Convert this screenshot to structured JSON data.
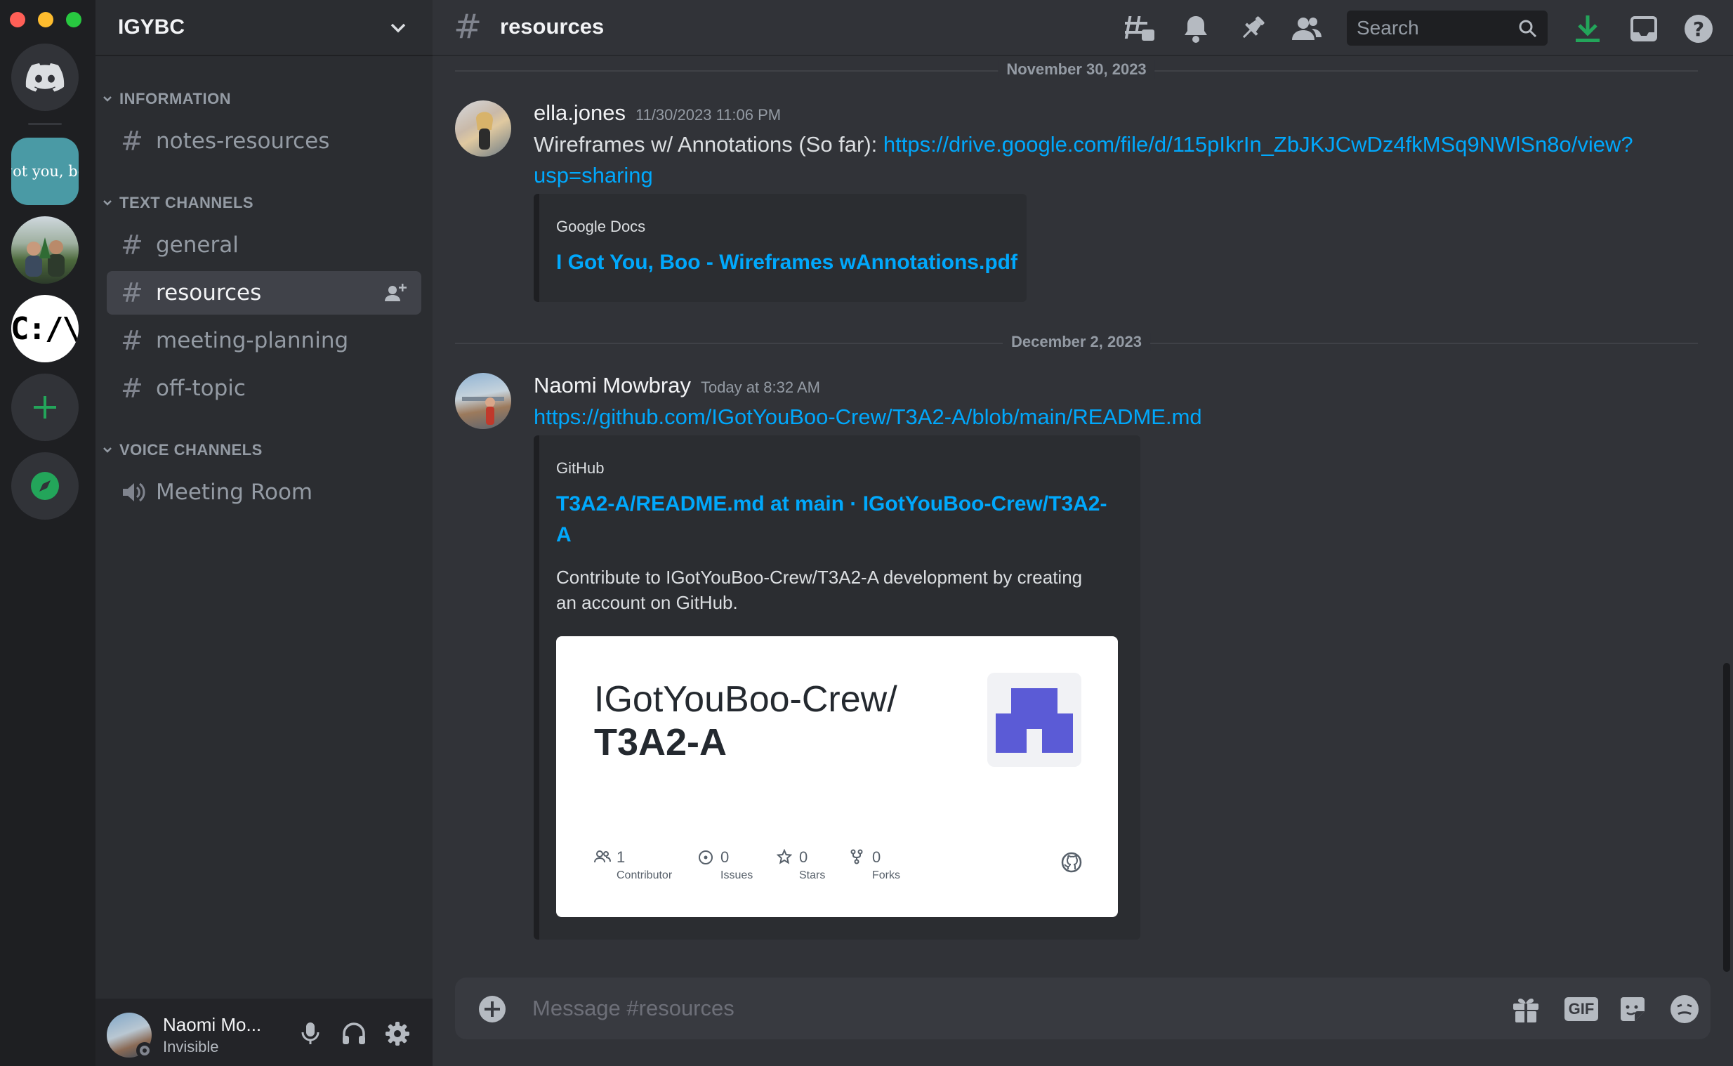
{
  "window": {
    "traffic_lights": {
      "close": "#ff5f57",
      "minimize": "#febc2e",
      "maximize": "#28c840"
    }
  },
  "servers": [
    {
      "name": "home-discord",
      "icon": "discord-logo-icon"
    },
    {
      "name": "got-you-boo",
      "label": "got you, bo"
    },
    {
      "name": "photo-server",
      "icon": "group-photo"
    },
    {
      "name": "ca-server",
      "label": "C:/\\"
    },
    {
      "name": "add-server",
      "icon": "plus-icon"
    },
    {
      "name": "explore",
      "icon": "compass-icon"
    }
  ],
  "guild": {
    "name": "IGYBC"
  },
  "categories": {
    "information": "INFORMATION",
    "text": "TEXT CHANNELS",
    "voice": "VOICE CHANNELS"
  },
  "channels": {
    "notes": "notes-resources",
    "general": "general",
    "resources": "resources",
    "meeting_planning": "meeting-planning",
    "off_topic": "off-topic",
    "meeting_room": "Meeting Room"
  },
  "user": {
    "name": "Naomi Mo...",
    "status": "Invisible"
  },
  "topbar": {
    "channel": "resources",
    "search_placeholder": "Search"
  },
  "messages": [
    {
      "date": "November 30, 2023",
      "author": "ella.jones",
      "time": "11/30/2023 11:06 PM",
      "text_prefix": "Wireframes w/ Annotations (So far): ",
      "link_line1": "https://drive.google.com/file/d/115pIkrIn_ZbJKJCwDz4fkMSq9NWlSn8o/view?",
      "link_line2": "usp=sharing",
      "embed": {
        "provider": "Google Docs",
        "title": "I Got You, Boo - Wireframes wAnnotations.pdf"
      }
    },
    {
      "date": "December 2, 2023",
      "author": "Naomi Mowbray",
      "time": "Today at 8:32 AM",
      "link": "https://github.com/IGotYouBoo-Crew/T3A2-A/blob/main/README.md",
      "embed": {
        "provider": "GitHub",
        "title_line1": "T3A2-A/README.md at main · IGotYouBoo-Crew/T3A2-",
        "title_line2": "A",
        "desc_line1": "Contribute to IGotYouBoo-Crew/T3A2-A development by creating",
        "desc_line2": "an account on GitHub.",
        "card": {
          "owner": "IGotYouBoo-Crew/",
          "repo": "T3A2-A",
          "stats": [
            {
              "value": "1",
              "label": "Contributor"
            },
            {
              "value": "0",
              "label": "Issues"
            },
            {
              "value": "0",
              "label": "Stars"
            },
            {
              "value": "0",
              "label": "Forks"
            }
          ]
        }
      }
    }
  ],
  "composer": {
    "placeholder": "Message #resources",
    "gif_label": "GIF"
  },
  "colors": {
    "accent_link": "#00a8fc",
    "online_green": "#23a55a",
    "blurple": "#5865f2"
  }
}
